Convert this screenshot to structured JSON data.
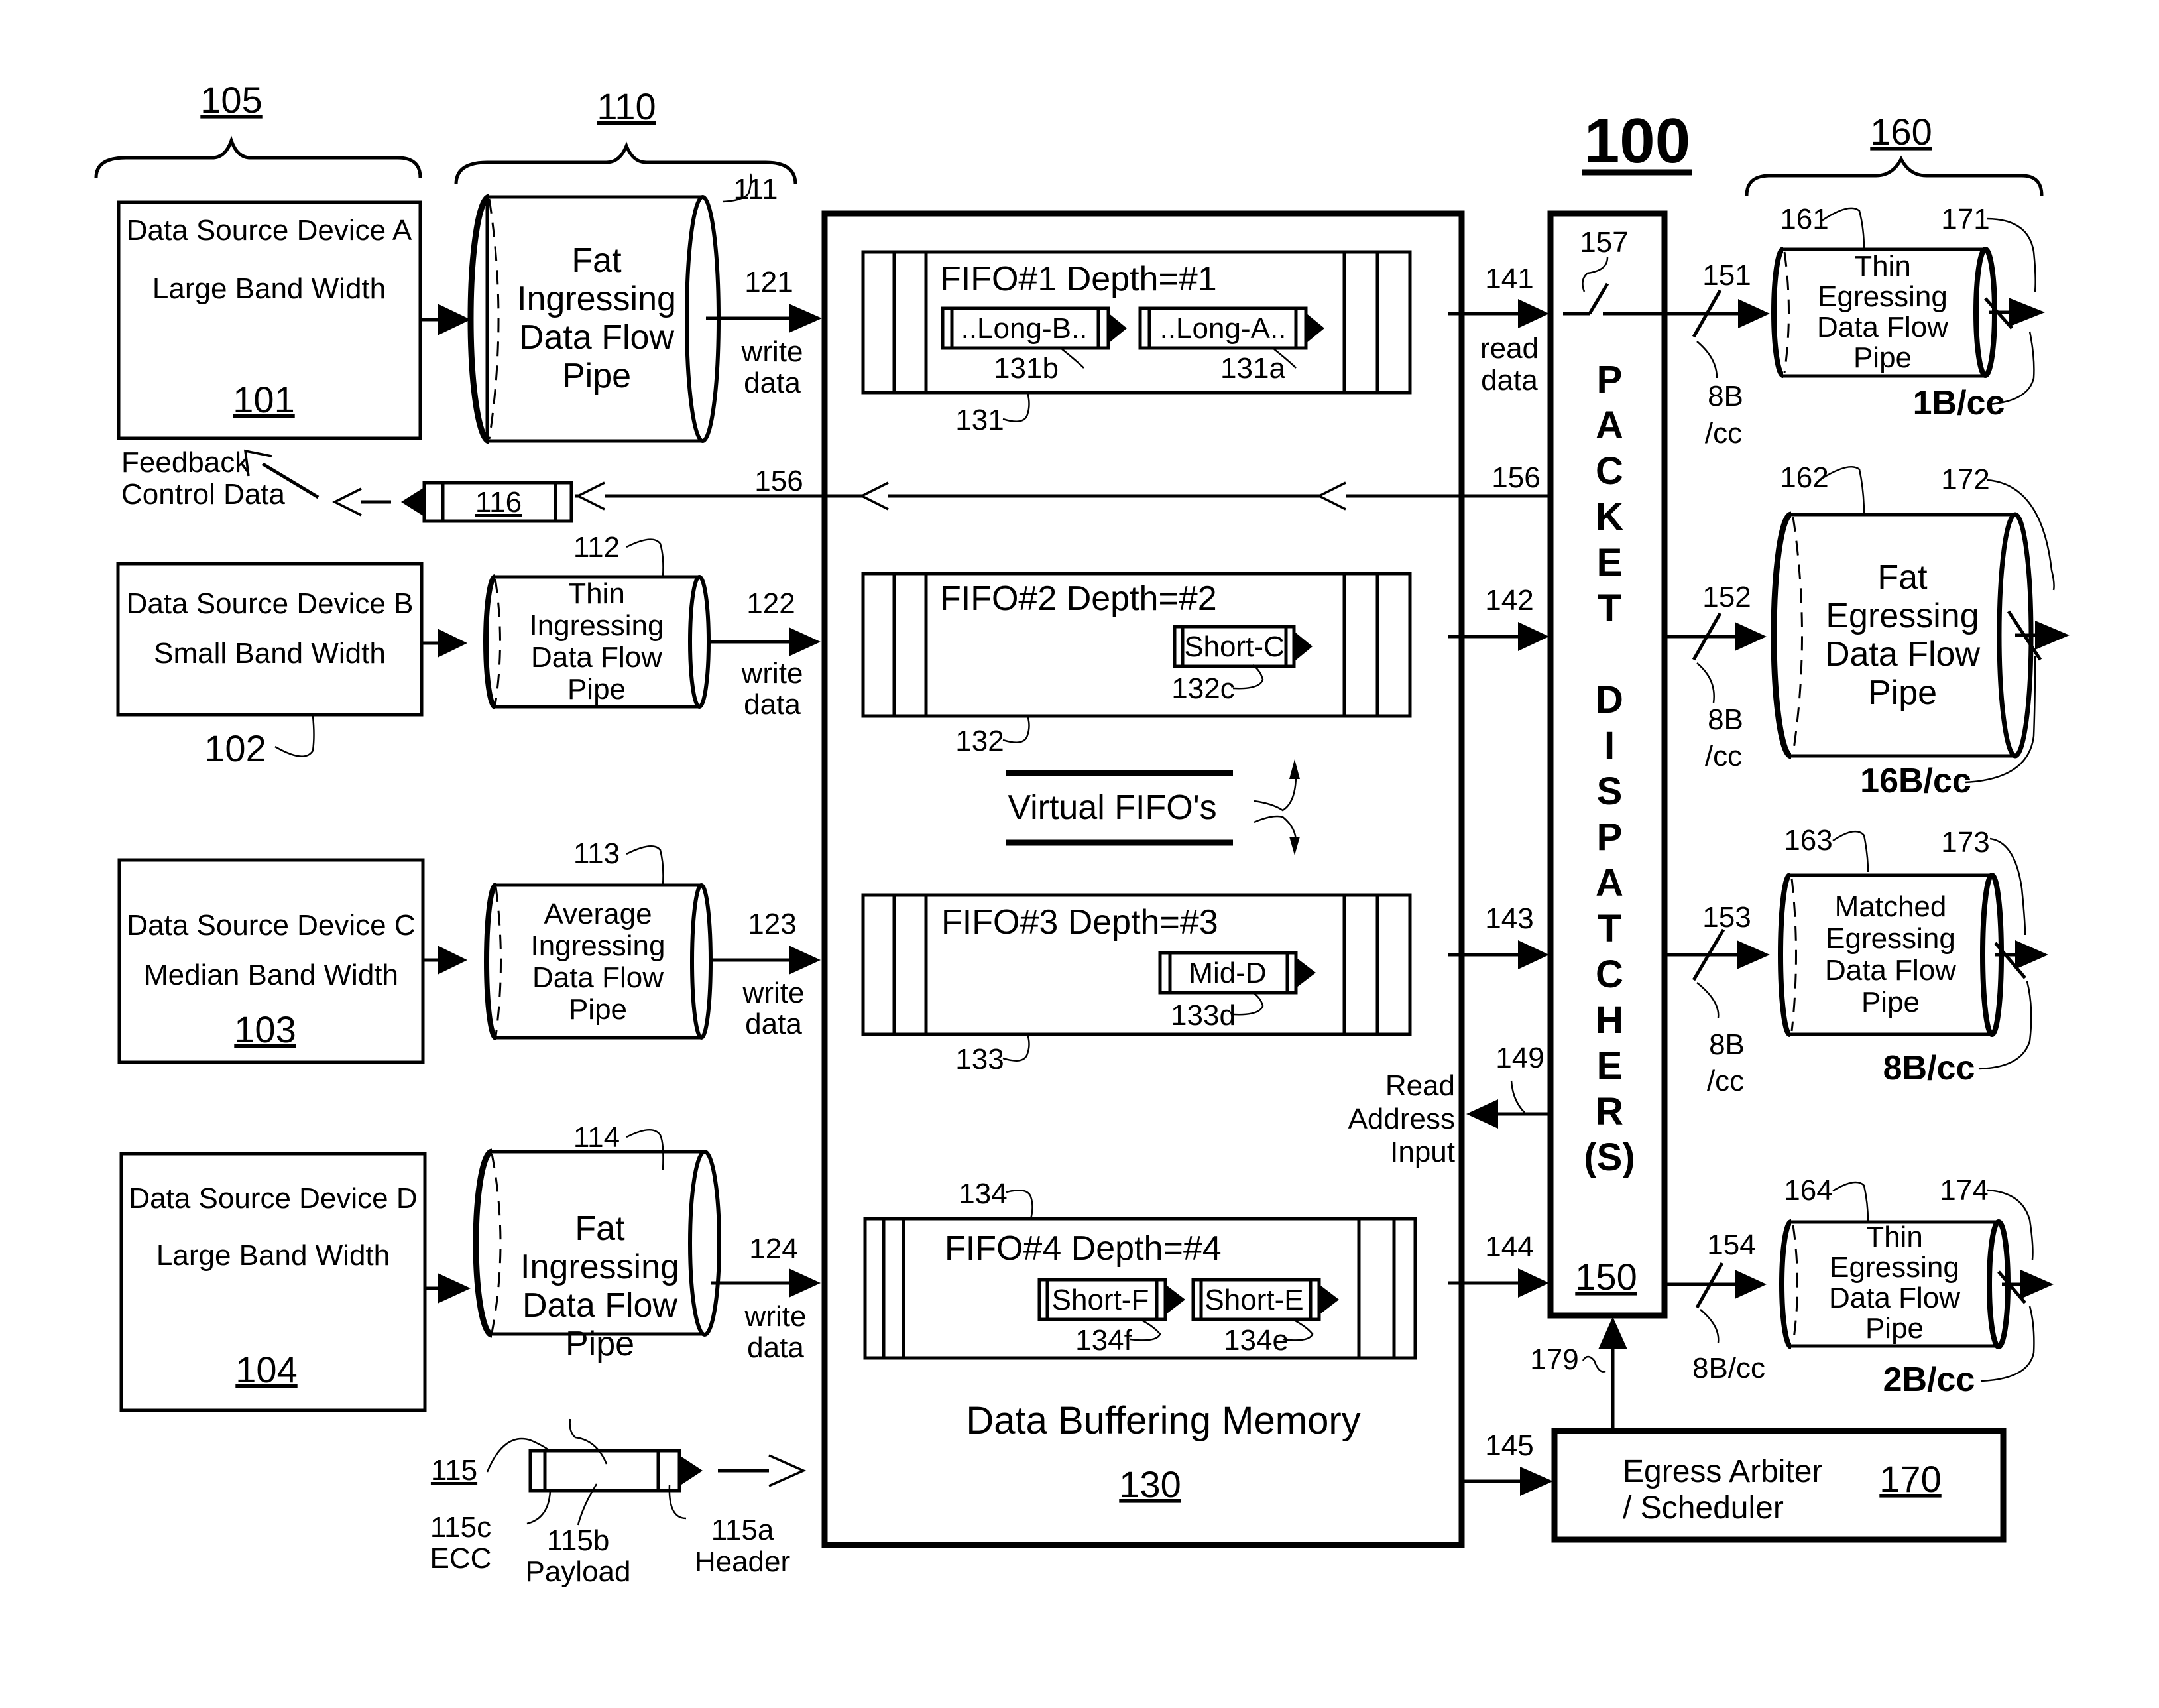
{
  "figure": {
    "title_ref": "100",
    "source_group_ref": "105",
    "ingress_group_ref": "110",
    "egress_group_ref": "160"
  },
  "sources": [
    {
      "ref": "101",
      "name": "Data Source Device A",
      "bandwidth": "Large Band Width"
    },
    {
      "ref": "102",
      "name": "Data Source Device B",
      "bandwidth": "Small Band Width"
    },
    {
      "ref": "103",
      "name": "Data Source Device C",
      "bandwidth": "Median Band Width"
    },
    {
      "ref": "104",
      "name": "Data Source Device D",
      "bandwidth": "Large Band Width"
    }
  ],
  "ingress_pipes": [
    {
      "ref": "111",
      "lines": [
        "Fat",
        "Ingressing",
        "Data Flow",
        "Pipe"
      ],
      "write_ref": "121"
    },
    {
      "ref": "112",
      "lines": [
        "Thin",
        "Ingressing",
        "Data Flow",
        "Pipe"
      ],
      "write_ref": "122"
    },
    {
      "ref": "113",
      "lines": [
        "Average",
        "Ingressing",
        "Data Flow",
        "Pipe"
      ],
      "write_ref": "123"
    },
    {
      "ref": "114",
      "lines": [
        "Fat",
        "Ingressing",
        "Data Flow",
        "Pipe"
      ],
      "write_ref": "124"
    }
  ],
  "write_label": [
    "write",
    "data"
  ],
  "read_label": [
    "read",
    "data"
  ],
  "feedback": {
    "line_ref": "156",
    "packet_ref": "116",
    "label": [
      "Feedback",
      "Control Data"
    ]
  },
  "packet_115": {
    "ref": "115",
    "ecc_ref": "115c",
    "ecc_label": "ECC",
    "payload_ref": "115b",
    "payload_label": "Payload",
    "header_ref": "115a",
    "header_label": "Header"
  },
  "memory": {
    "ref": "130",
    "label": "Data Buffering Memory",
    "virtual_label": "Virtual FIFO's",
    "fifos": [
      {
        "ref": "131",
        "title": "FIFO#1 Depth=#1",
        "read_ref": "141",
        "packets": [
          {
            "label": "..Long-B..",
            "ref": "131b"
          },
          {
            "label": "..Long-A..",
            "ref": "131a"
          }
        ]
      },
      {
        "ref": "132",
        "title": "FIFO#2 Depth=#2",
        "read_ref": "142",
        "packets": [
          {
            "label": "Short-C",
            "ref": "132c"
          }
        ]
      },
      {
        "ref": "133",
        "title": "FIFO#3 Depth=#3",
        "read_ref": "143",
        "packets": [
          {
            "label": "Mid-D",
            "ref": "133d"
          }
        ]
      },
      {
        "ref": "134",
        "title": "FIFO#4 Depth=#4",
        "read_ref": "144",
        "packets": [
          {
            "label": "Short-F",
            "ref": "134f"
          },
          {
            "label": "Short-E",
            "ref": "134e"
          }
        ]
      }
    ],
    "read_address": {
      "ref": "149",
      "label": [
        "Read",
        "Address",
        "Input"
      ]
    },
    "arbiter_link_ref": "145"
  },
  "dispatcher": {
    "ref": "150",
    "switch_ref": "157",
    "letters": [
      "P",
      "A",
      "C",
      "K",
      "E",
      "T",
      "",
      "D",
      "I",
      "S",
      "P",
      "A",
      "T",
      "C",
      "H",
      "E",
      "R",
      "(S)"
    ]
  },
  "egress_pipes": [
    {
      "pipe_ref": "161",
      "out_ref": "171",
      "link_ref": "151",
      "link_rate": [
        "8B",
        "/cc"
      ],
      "lines": [
        "Thin",
        "Egressing",
        "Data Flow",
        "Pipe"
      ],
      "rate": "1B/cc"
    },
    {
      "pipe_ref": "162",
      "out_ref": "172",
      "link_ref": "152",
      "link_rate": [
        "8B",
        "/cc"
      ],
      "lines": [
        "Fat",
        "Egressing",
        "Data Flow",
        "Pipe"
      ],
      "rate": "16B/cc"
    },
    {
      "pipe_ref": "163",
      "out_ref": "173",
      "link_ref": "153",
      "link_rate": [
        "8B",
        "/cc"
      ],
      "lines": [
        "Matched",
        "Egressing",
        "Data Flow",
        "Pipe"
      ],
      "rate": "8B/cc"
    },
    {
      "pipe_ref": "164",
      "out_ref": "174",
      "link_ref": "154",
      "link_rate": [
        "8B/cc",
        ""
      ],
      "lines": [
        "Thin",
        "Egressing",
        "Data Flow",
        "Pipe"
      ],
      "rate": "2B/cc"
    }
  ],
  "arbiter": {
    "ref": "170",
    "lines": [
      "Egress Arbiter",
      "/ Scheduler"
    ],
    "link_ref": "179"
  }
}
